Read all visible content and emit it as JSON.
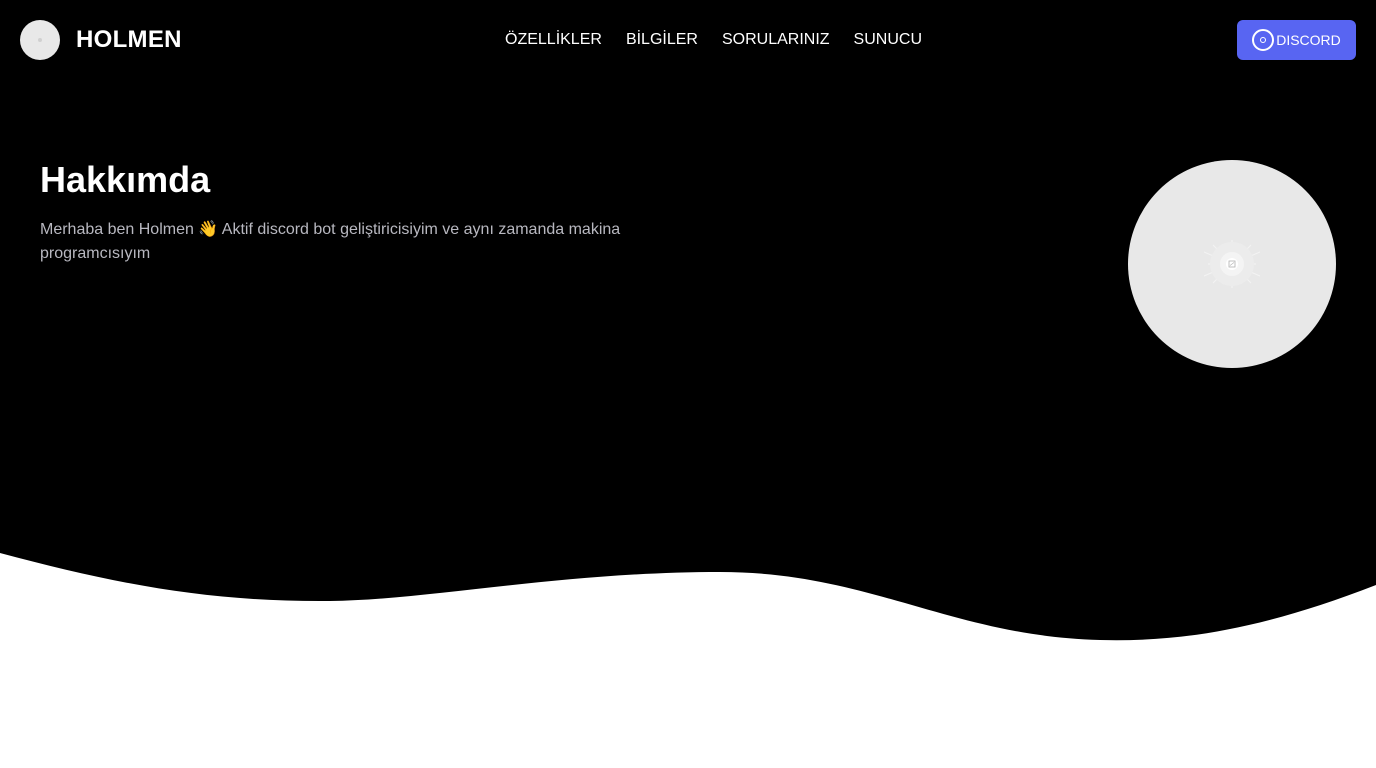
{
  "header": {
    "brand": "HOLMEN",
    "nav": [
      {
        "label": "ÖZELLİKLER"
      },
      {
        "label": "BİLGİLER"
      },
      {
        "label": "SORULARINIZ"
      },
      {
        "label": "SUNUCU"
      }
    ],
    "discord_label": "DISCORD"
  },
  "about": {
    "title": "Hakkımda",
    "text": "Merhaba ben Holmen 👋 Aktif discord bot geliştiricisiyim ve aynı zamanda makina programcısıyım"
  },
  "colors": {
    "hero_background": "#000000",
    "page_background": "#ffffff",
    "discord_accent": "#5865f2",
    "avatar_placeholder": "#e8e8e8"
  },
  "icons": {
    "discord_button": "discord-icon",
    "profile": "broken-image-icon"
  }
}
